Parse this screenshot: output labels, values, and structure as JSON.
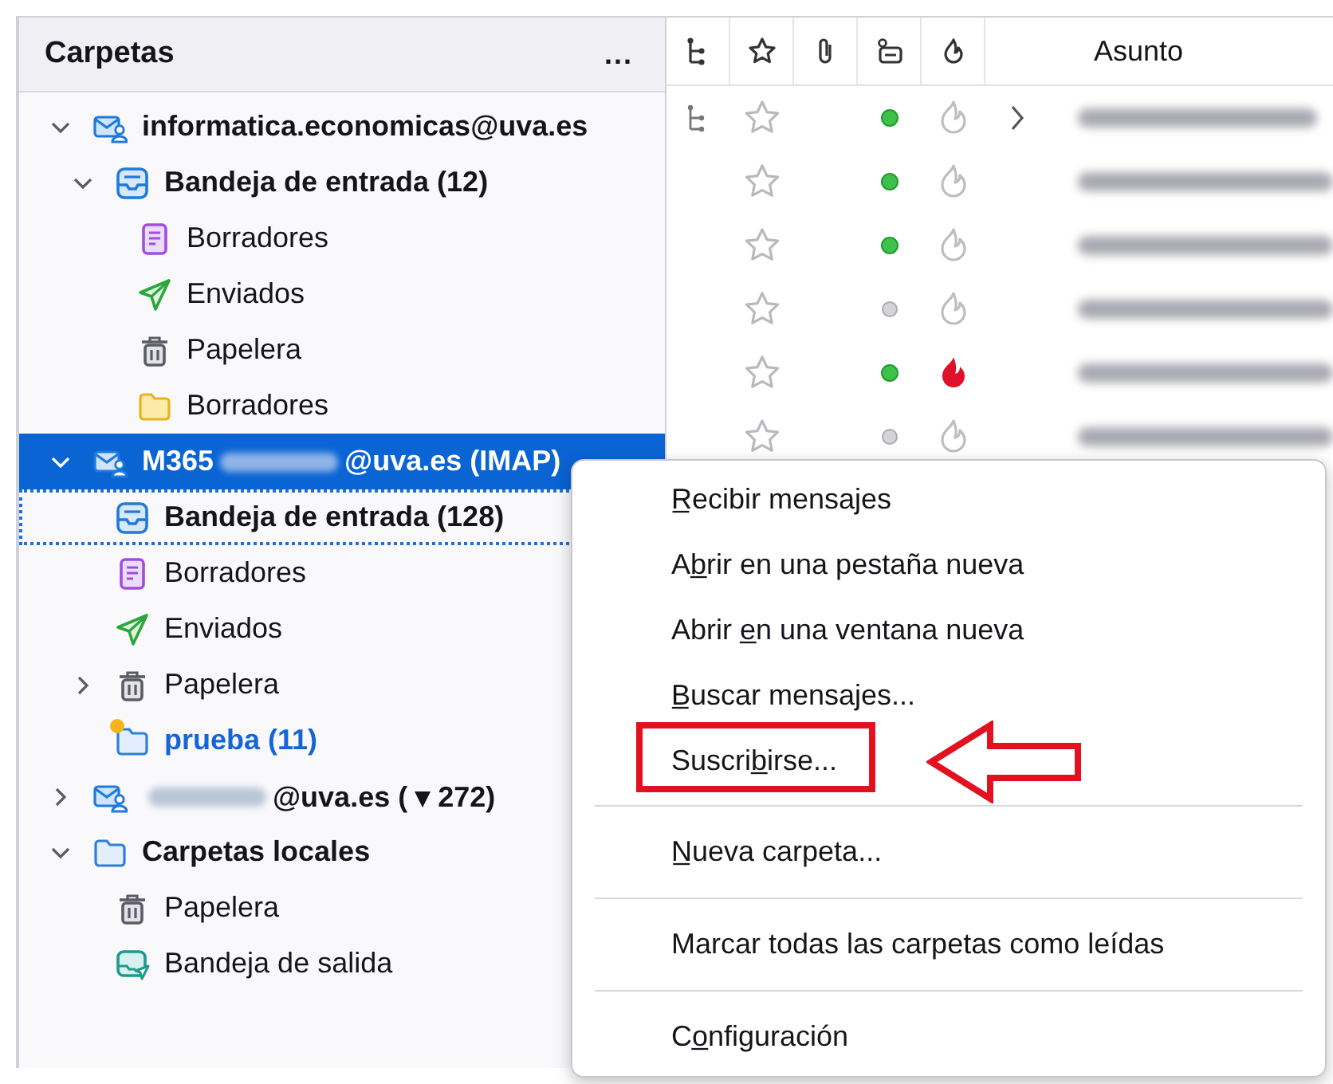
{
  "folder_pane": {
    "title": "Carpetas",
    "more_button": "...",
    "folders": [
      {
        "kind": "account",
        "label": "informatica.economicas@uva.es",
        "bold": true,
        "selected": false,
        "focused": false,
        "new": false,
        "expanded": true,
        "children": [
          {
            "kind": "inbox",
            "label": "Bandeja de entrada (12)",
            "bold": true,
            "selected": false,
            "focused": false,
            "new": false,
            "expanded": true,
            "children": [
              {
                "kind": "drafts",
                "label": "Borradores",
                "bold": false,
                "selected": false,
                "focused": false,
                "new": false
              },
              {
                "kind": "sent",
                "label": "Enviados",
                "bold": false,
                "selected": false,
                "focused": false,
                "new": false
              },
              {
                "kind": "trash",
                "label": "Papelera",
                "bold": false,
                "selected": false,
                "focused": false,
                "new": false
              },
              {
                "kind": "folder",
                "label": "Borradores",
                "bold": false,
                "selected": false,
                "focused": false,
                "new": false
              }
            ]
          }
        ]
      },
      {
        "kind": "account",
        "label_parts": [
          {
            "kind": "text",
            "text": "M365"
          },
          {
            "kind": "redacted"
          },
          {
            "kind": "text",
            "text": "@uva.es (IMAP)"
          }
        ],
        "bold": true,
        "selected": true,
        "focused": false,
        "new": false,
        "expanded": true,
        "children": [
          {
            "kind": "inbox",
            "label": "Bandeja de entrada (128)",
            "bold": true,
            "selected": false,
            "focused": true,
            "new": false
          },
          {
            "kind": "drafts",
            "label": "Borradores",
            "bold": false,
            "selected": false,
            "focused": false,
            "new": false
          },
          {
            "kind": "sent",
            "label": "Enviados",
            "bold": false,
            "selected": false,
            "focused": false,
            "new": false
          },
          {
            "kind": "trash",
            "label": "Papelera",
            "bold": false,
            "selected": false,
            "focused": false,
            "new": false,
            "expanded": false
          },
          {
            "kind": "custom",
            "label": "prueba (11)",
            "bold": true,
            "selected": false,
            "focused": false,
            "new": true
          }
        ]
      },
      {
        "kind": "account",
        "label_parts": [
          {
            "kind": "redacted"
          },
          {
            "kind": "text",
            "text": "@uva.es ( ▾ 272)"
          }
        ],
        "bold": true,
        "selected": false,
        "focused": false,
        "new": false,
        "expanded": false
      },
      {
        "kind": "local",
        "label": "Carpetas locales",
        "bold": true,
        "selected": false,
        "focused": false,
        "new": false,
        "expanded": true,
        "children": [
          {
            "kind": "trash",
            "label": "Papelera",
            "bold": false,
            "selected": false,
            "focused": false,
            "new": false
          },
          {
            "kind": "outbox",
            "label": "Bandeja de salida",
            "bold": false,
            "selected": false,
            "focused": false,
            "new": false
          }
        ]
      }
    ]
  },
  "message_list": {
    "subject_header": "Asunto",
    "rows": [
      {
        "thread": true,
        "starred": false,
        "read": false,
        "junk": false
      },
      {
        "thread": false,
        "starred": false,
        "read": false,
        "junk": false
      },
      {
        "thread": false,
        "starred": false,
        "read": false,
        "junk": false
      },
      {
        "thread": false,
        "starred": false,
        "read": true,
        "junk": false
      },
      {
        "thread": false,
        "starred": false,
        "read": false,
        "junk": true
      },
      {
        "thread": false,
        "starred": false,
        "read": true,
        "junk": false
      }
    ]
  },
  "context_menu": {
    "items": [
      {
        "kind": "item",
        "label": "R̲ecibir mensajes",
        "highlighted": false
      },
      {
        "kind": "item",
        "label": "Ab̲rir en una pestaña nueva",
        "highlighted": false
      },
      {
        "kind": "item",
        "label": "Abrir e̲n una ventana nueva",
        "highlighted": false
      },
      {
        "kind": "item",
        "label": "B̲uscar mensajes...",
        "highlighted": false
      },
      {
        "kind": "item",
        "label": "Suscrib̲irse...",
        "highlighted": true
      },
      {
        "kind": "separator"
      },
      {
        "kind": "item",
        "label": "N̲ueva carpeta...",
        "highlighted": false
      },
      {
        "kind": "separator"
      },
      {
        "kind": "item",
        "label": "Marcar todas las carpetas como leídas",
        "highlighted": false
      },
      {
        "kind": "separator"
      },
      {
        "kind": "item",
        "label": "Co̲nfiguración",
        "highlighted": false
      }
    ]
  }
}
